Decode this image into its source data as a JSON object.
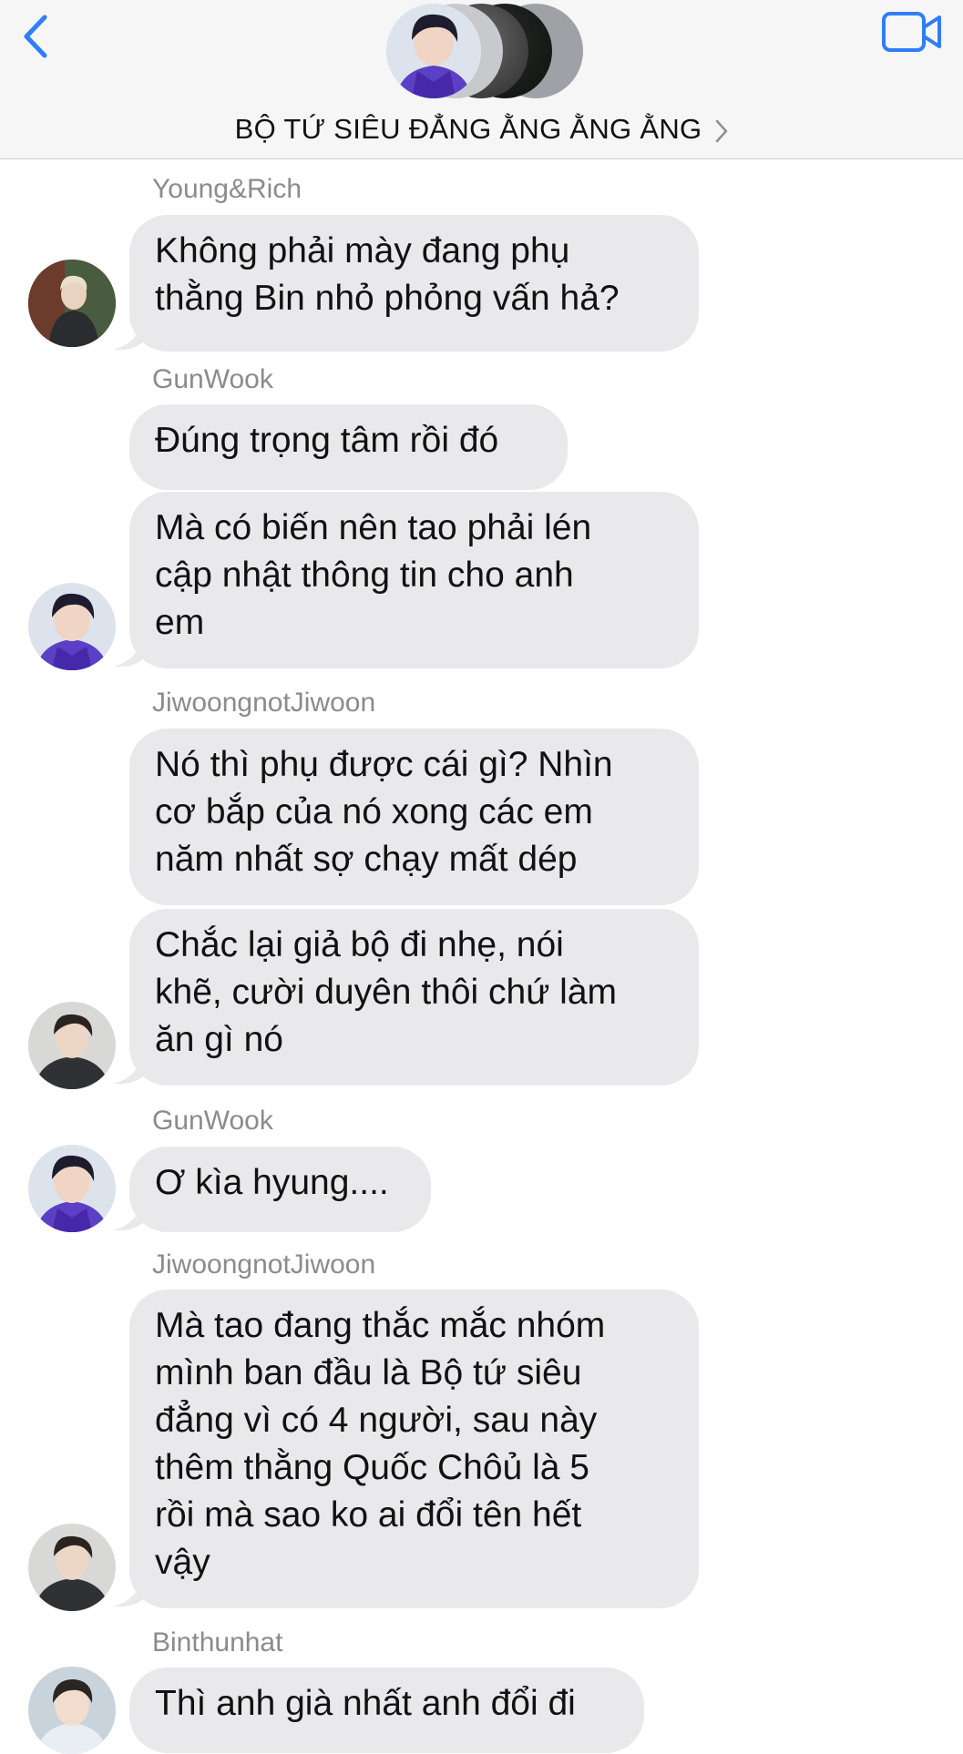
{
  "header": {
    "group_name": "BỘ TỨ SIÊU ĐẲNG ẰNG ẰNG ẰNG"
  },
  "colors": {
    "accent": "#2f7ef6",
    "bubble": "#e9e9eb",
    "sender": "#8b8b8f"
  },
  "icons": [
    "chevron-left-icon",
    "video-camera-icon",
    "chevron-right-icon"
  ],
  "messages": [
    {
      "sender": "Young&Rich",
      "lines": [
        "Không phải mày đang phụ",
        "thằng Bin nhỏ phỏng vấn hả?"
      ]
    },
    {
      "sender": "GunWook",
      "lines": [
        "Đúng trọng tâm rồi đó"
      ]
    },
    {
      "lines": [
        "Mà có biến nên tao phải lén",
        "cập nhật thông tin cho anh",
        "em"
      ]
    },
    {
      "sender": "JiwoongnotJiwoon",
      "lines": [
        "Nó thì phụ được cái gì? Nhìn",
        "cơ bắp của nó xong các em",
        "năm nhất sợ chạy mất dép"
      ]
    },
    {
      "lines": [
        "Chắc lại giả bộ đi nhẹ, nói",
        "khẽ, cười duyên thôi chứ làm",
        "ăn gì nó"
      ]
    },
    {
      "sender": "GunWook",
      "lines": [
        "Ơ kìa hyung...."
      ]
    },
    {
      "sender": "JiwoongnotJiwoon",
      "lines": [
        "Mà tao đang thắc mắc nhóm",
        "mình ban đầu là Bộ tứ siêu",
        "đẳng vì có 4 người, sau này",
        "thêm thằng Quốc Chôủ là 5",
        "rồi mà sao ko ai đổi tên hết",
        "vậy"
      ]
    },
    {
      "sender": "Binthunhat",
      "lines": [
        "Thì anh già nhất anh đổi đi"
      ]
    }
  ]
}
